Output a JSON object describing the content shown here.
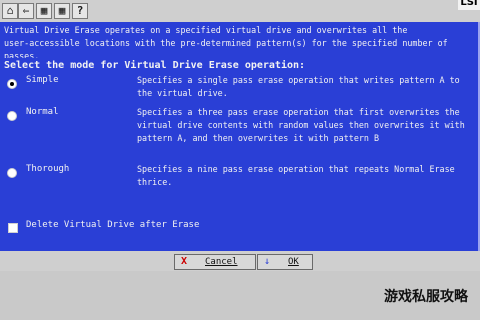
{
  "toolbar": {
    "icons": [
      "home-icon",
      "back-icon",
      "grid-icon",
      "grid-icon",
      "help-icon"
    ],
    "help_glyph": "?",
    "logo_text": "LSI"
  },
  "panel": {
    "intro": "Virtual Drive Erase operates on a specified virtual drive and overwrites all the\nuser-accessible locations with the pre-determined pattern(s) for the specified number of\npasses.",
    "mode_heading": "Select the mode for Virtual Drive Erase operation:",
    "options": [
      {
        "label": "Simple",
        "description": "Specifies a single pass erase operation that writes pattern A to\nthe virtual drive.",
        "selected": true
      },
      {
        "label": "Normal",
        "description": "Specifies a three pass erase operation that first overwrites the\nvirtual drive contents with random values then overwrites it with\npattern A, and then overwrites it with pattern B",
        "selected": false
      },
      {
        "label": "Thorough",
        "description": "Specifies a nine pass erase operation that repeats Normal Erase\nthrice.",
        "selected": false
      }
    ],
    "delete_checkbox_label": "Delete Virtual Drive after Erase",
    "delete_checked": false
  },
  "buttons": {
    "cancel": {
      "label": "Cancel",
      "icon": "X"
    },
    "ok": {
      "label": "OK",
      "icon": "↓"
    }
  },
  "watermark": "游戏私服攻略",
  "colors": {
    "panel_bg": "#2a3fd6",
    "panel_text": "#f2f2f2",
    "frame": "#c9c9c9"
  }
}
